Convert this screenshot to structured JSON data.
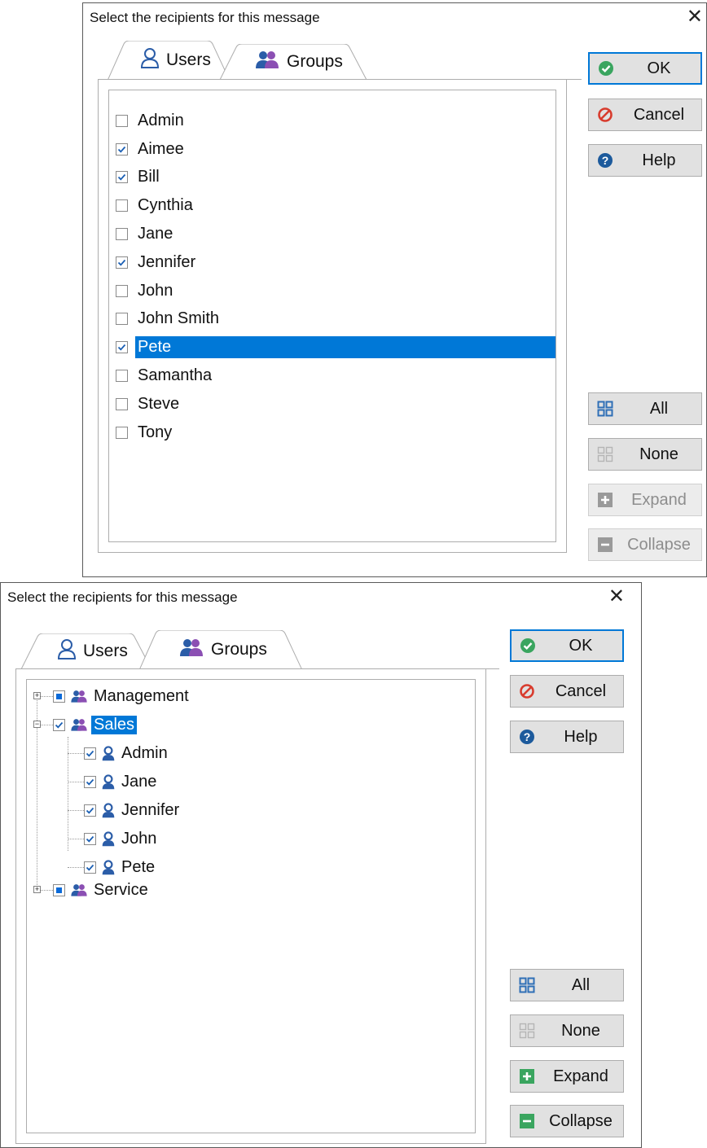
{
  "dialog1": {
    "title": "Select the recipients for this message",
    "close_glyph": "✕",
    "tabs": [
      {
        "label": "Users",
        "active": true,
        "icon": "user-icon"
      },
      {
        "label": "Groups",
        "active": false,
        "icon": "group-icon"
      }
    ],
    "users": [
      {
        "name": "Admin",
        "checked": false
      },
      {
        "name": "Aimee",
        "checked": true
      },
      {
        "name": "Bill",
        "checked": true
      },
      {
        "name": "Cynthia",
        "checked": false
      },
      {
        "name": "Jane",
        "checked": false
      },
      {
        "name": "Jennifer",
        "checked": true
      },
      {
        "name": "John",
        "checked": false
      },
      {
        "name": "John Smith",
        "checked": false
      },
      {
        "name": "Pete",
        "checked": true,
        "selected": true
      },
      {
        "name": "Samantha",
        "checked": false
      },
      {
        "name": "Steve",
        "checked": false
      },
      {
        "name": "Tony",
        "checked": false
      }
    ],
    "buttons": {
      "ok": "OK",
      "cancel": "Cancel",
      "help": "Help",
      "all": "All",
      "none": "None",
      "expand": "Expand",
      "collapse": "Collapse"
    }
  },
  "dialog2": {
    "title": "Select the recipients for this message",
    "close_glyph": "✕",
    "tabs": [
      {
        "label": "Users",
        "active": false,
        "icon": "user-icon"
      },
      {
        "label": "Groups",
        "active": true,
        "icon": "group-icon"
      }
    ],
    "groups": [
      {
        "name": "Management",
        "expanded": false,
        "state": "partial"
      },
      {
        "name": "Sales",
        "expanded": true,
        "state": "checked",
        "selected": true,
        "members": [
          "Admin",
          "Jane",
          "Jennifer",
          "John",
          "Pete"
        ]
      },
      {
        "name": "Service",
        "expanded": false,
        "state": "partial"
      }
    ],
    "buttons": {
      "ok": "OK",
      "cancel": "Cancel",
      "help": "Help",
      "all": "All",
      "none": "None",
      "expand": "Expand",
      "collapse": "Collapse"
    }
  },
  "colors": {
    "selection": "#0078d7",
    "ok_green": "#3aa55f",
    "cancel_red": "#d83b2d",
    "help_blue": "#1c5a9c",
    "user_icon_blue": "#2b5da8",
    "group_icon_purple": "#8b4fb3",
    "grid_blue": "#2f6fb6",
    "expand_green": "#3aa55f"
  }
}
